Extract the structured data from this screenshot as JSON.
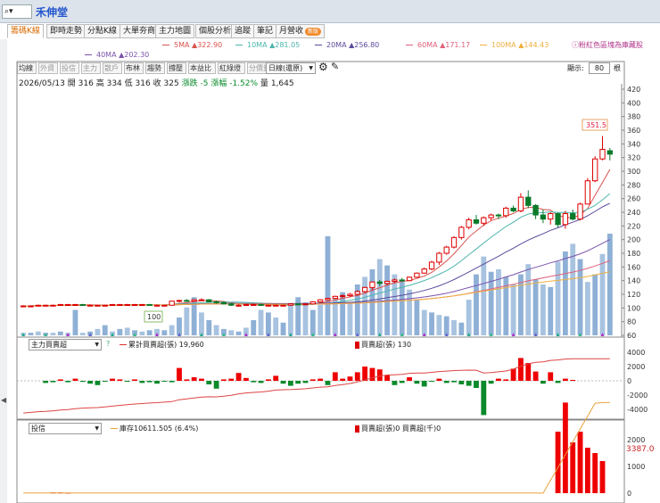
{
  "header": {
    "search_value": "⌕▾",
    "stock_name": "禾伸堂"
  },
  "tabs": [
    {
      "label": "籌碼K線",
      "active": true
    },
    {
      "label": "即時走勢"
    },
    {
      "label": "分點K線"
    },
    {
      "label": "大單夯商"
    },
    {
      "label": "主力地圖"
    },
    {
      "label": "個股分析"
    },
    {
      "label": "追蹤"
    },
    {
      "label": "筆記"
    },
    {
      "label": "月營收",
      "badge": "新版"
    }
  ],
  "ma_legend": [
    {
      "label": "5MA ▲322.90",
      "color": "#d9534f"
    },
    {
      "label": "10MA ▲281.05",
      "color": "#4db6ac"
    },
    {
      "label": "20MA ▲256.80",
      "color": "#5c4a9c"
    },
    {
      "label": "60MA ▲171.17",
      "color": "#e0607a"
    },
    {
      "label": "100MA ▲144.43",
      "color": "#f0b040"
    },
    {
      "label": "40MA ▲202.30",
      "color": "#7b52ab"
    }
  ],
  "hint": "ⓘ粉紅色區塊為庫藏股",
  "toolbar": {
    "buttons": [
      {
        "label": "均線"
      },
      {
        "label": "外資",
        "dim": true
      },
      {
        "label": "投信",
        "dim": true
      },
      {
        "label": "主力",
        "dim": true
      },
      {
        "label": "散戶",
        "dim": true
      },
      {
        "label": "布林"
      },
      {
        "label": "趨勢"
      },
      {
        "label": "撐壓"
      },
      {
        "label": "本益比"
      },
      {
        "label": "紅綠燈"
      },
      {
        "label": "分價量",
        "dim": true
      }
    ],
    "period": "日線(還原)",
    "display_label": "顯示:",
    "display_value": "80",
    "display_unit": "根"
  },
  "quote": {
    "date": "2026/05/13",
    "open_label": "開",
    "open": "316",
    "high_label": "高",
    "high": "334",
    "low_label": "低",
    "low": "316",
    "close_label": "收",
    "close": "325",
    "change_label": "漲跌",
    "change": "-5",
    "pct_label": "漲幅",
    "pct": "-1.52%",
    "vol_label": "量",
    "vol": "1,645"
  },
  "price_axis": {
    "ticks": [
      "420",
      "400",
      "380",
      "360",
      "340",
      "320",
      "300",
      "280",
      "260",
      "240",
      "220",
      "200",
      "180",
      "160",
      "140",
      "120",
      "100",
      "80",
      "60"
    ]
  },
  "annotations": {
    "high_marker": "351.5",
    "low_marker": "100"
  },
  "panel2": {
    "select": "主力買賣超",
    "help": "?",
    "legend1": "累計買賣超(張) 19,960",
    "legend2": "買賣超(張) 130",
    "ticks": [
      "4000",
      "2000",
      "0",
      "-2000",
      "-4000"
    ]
  },
  "panel3": {
    "select": "投信",
    "legend1": "庫存10611.505 (6.4%)",
    "legend2": "買賣超(張)0 買賣超(千)0",
    "value_label": "3387.0",
    "ticks": [
      "2000",
      "1000",
      "0"
    ]
  },
  "chart_data": {
    "type": "candlestick",
    "candles": [
      [
        103,
        104,
        102,
        103
      ],
      [
        103,
        104,
        102,
        103
      ],
      [
        103,
        105,
        102,
        104
      ],
      [
        104,
        105,
        103,
        104
      ],
      [
        104,
        105,
        103,
        104
      ],
      [
        104,
        106,
        103,
        105
      ],
      [
        105,
        106,
        104,
        105
      ],
      [
        105,
        106,
        104,
        105
      ],
      [
        105,
        106,
        103,
        104
      ],
      [
        104,
        105,
        103,
        104
      ],
      [
        104,
        105,
        103,
        104
      ],
      [
        104,
        105,
        103,
        104
      ],
      [
        104,
        106,
        103,
        105
      ],
      [
        105,
        106,
        104,
        105
      ],
      [
        105,
        106,
        104,
        105
      ],
      [
        105,
        106,
        104,
        105
      ],
      [
        105,
        106,
        104,
        105
      ],
      [
        105,
        106,
        104,
        104
      ],
      [
        104,
        105,
        103,
        104
      ],
      [
        104,
        105,
        103,
        104
      ],
      [
        104,
        110,
        104,
        110
      ],
      [
        110,
        112,
        108,
        111
      ],
      [
        111,
        113,
        109,
        110
      ],
      [
        110,
        113,
        109,
        112
      ],
      [
        112,
        114,
        110,
        112
      ],
      [
        112,
        113,
        108,
        109
      ],
      [
        109,
        111,
        106,
        108
      ],
      [
        108,
        110,
        105,
        106
      ],
      [
        106,
        107,
        103,
        104
      ],
      [
        104,
        106,
        102,
        104
      ],
      [
        104,
        106,
        103,
        105
      ],
      [
        105,
        106,
        104,
        105
      ],
      [
        105,
        106,
        103,
        104
      ],
      [
        104,
        105,
        103,
        104
      ],
      [
        104,
        105,
        103,
        104
      ],
      [
        104,
        105,
        103,
        104
      ],
      [
        104,
        107,
        103,
        106
      ],
      [
        106,
        107,
        104,
        105
      ],
      [
        105,
        107,
        104,
        106
      ],
      [
        106,
        110,
        105,
        109
      ],
      [
        109,
        113,
        108,
        112
      ],
      [
        112,
        115,
        111,
        114
      ],
      [
        114,
        118,
        113,
        117
      ],
      [
        117,
        120,
        115,
        118
      ],
      [
        118,
        122,
        116,
        120
      ],
      [
        120,
        126,
        118,
        124
      ],
      [
        124,
        131,
        122,
        130
      ],
      [
        130,
        139,
        126,
        138
      ],
      [
        138,
        141,
        132,
        136
      ],
      [
        136,
        140,
        133,
        139
      ],
      [
        139,
        143,
        136,
        141
      ],
      [
        141,
        144,
        138,
        140
      ],
      [
        140,
        146,
        139,
        145
      ],
      [
        145,
        152,
        144,
        151
      ],
      [
        151,
        159,
        150,
        157
      ],
      [
        157,
        169,
        155,
        167
      ],
      [
        167,
        182,
        163,
        180
      ],
      [
        180,
        191,
        178,
        189
      ],
      [
        189,
        205,
        187,
        203
      ],
      [
        203,
        220,
        200,
        218
      ],
      [
        218,
        232,
        215,
        229
      ],
      [
        229,
        236,
        222,
        224
      ],
      [
        224,
        234,
        220,
        232
      ],
      [
        232,
        238,
        228,
        236
      ],
      [
        236,
        238,
        230,
        235
      ],
      [
        235,
        248,
        232,
        246
      ],
      [
        246,
        250,
        240,
        242
      ],
      [
        242,
        268,
        240,
        262
      ],
      [
        262,
        272,
        246,
        250
      ],
      [
        250,
        252,
        230,
        236
      ],
      [
        236,
        244,
        224,
        230
      ],
      [
        230,
        240,
        222,
        238
      ],
      [
        238,
        240,
        218,
        222
      ],
      [
        222,
        242,
        216,
        238
      ],
      [
        238,
        244,
        228,
        230
      ],
      [
        230,
        254,
        228,
        252
      ],
      [
        252,
        290,
        252,
        286
      ],
      [
        286,
        322,
        284,
        318
      ],
      [
        318,
        351.5,
        316,
        332
      ],
      [
        330,
        334,
        316,
        325
      ]
    ],
    "volume_bar_heights": [
      2,
      2,
      3,
      2,
      2,
      3,
      2,
      20,
      2,
      3,
      5,
      8,
      3,
      5,
      6,
      4,
      3,
      4,
      5,
      4,
      8,
      14,
      22,
      30,
      18,
      12,
      8,
      5,
      4,
      3,
      6,
      12,
      20,
      18,
      14,
      10,
      25,
      30,
      26,
      20,
      24,
      78,
      30,
      34,
      26,
      40,
      46,
      52,
      60,
      55,
      48,
      42,
      36,
      28,
      20,
      18,
      16,
      15,
      12,
      10,
      28,
      48,
      62,
      50,
      52,
      46,
      40,
      48,
      56,
      44,
      40,
      38,
      58,
      66,
      72,
      60,
      42,
      48,
      64,
      80
    ],
    "volume_bar_colors": "alternating blue tones",
    "ma_lines": {
      "5MA": "follows close",
      "10MA": "smoothed",
      "20MA": "smoother",
      "60MA": "slow",
      "100MA": "slowest"
    },
    "main_buysell": [
      0,
      0,
      0,
      -300,
      -200,
      200,
      -200,
      300,
      -150,
      -400,
      -600,
      -100,
      300,
      200,
      -100,
      200,
      -300,
      -200,
      -400,
      -100,
      -200,
      1800,
      200,
      500,
      300,
      -500,
      -1100,
      200,
      300,
      1100,
      400,
      -200,
      -300,
      200,
      700,
      -400,
      -700,
      -400,
      -300,
      200,
      300,
      -600,
      1200,
      300,
      600,
      1200,
      2000,
      1800,
      1600,
      800,
      -600,
      -300,
      500,
      -400,
      -800,
      -100,
      300,
      -300,
      -200,
      -500,
      -700,
      -1000,
      -4800,
      -400,
      300,
      200,
      1700,
      3200,
      2500,
      1300,
      -400,
      1200,
      -300,
      300,
      130,
      0,
      0,
      0,
      0,
      0
    ],
    "main_cumulative": "cumulative line from ~-4500 up to ~3000",
    "trust_buysell": [
      0,
      0,
      0,
      0,
      30,
      30,
      20,
      0,
      0,
      0,
      0,
      0,
      0,
      0,
      0,
      0,
      0,
      0,
      0,
      0,
      0,
      0,
      0,
      0,
      0,
      0,
      0,
      0,
      0,
      0,
      0,
      0,
      0,
      0,
      0,
      0,
      0,
      0,
      0,
      0,
      0,
      0,
      0,
      0,
      0,
      0,
      0,
      0,
      0,
      0,
      0,
      0,
      0,
      0,
      0,
      0,
      0,
      0,
      0,
      0,
      0,
      0,
      0,
      0,
      0,
      0,
      0,
      0,
      0,
      0,
      0,
      0,
      2300,
      3387,
      1900,
      2300,
      1700,
      1500,
      1200,
      0
    ],
    "trust_cumulative": "flat near 0 then rising to ~3387"
  }
}
